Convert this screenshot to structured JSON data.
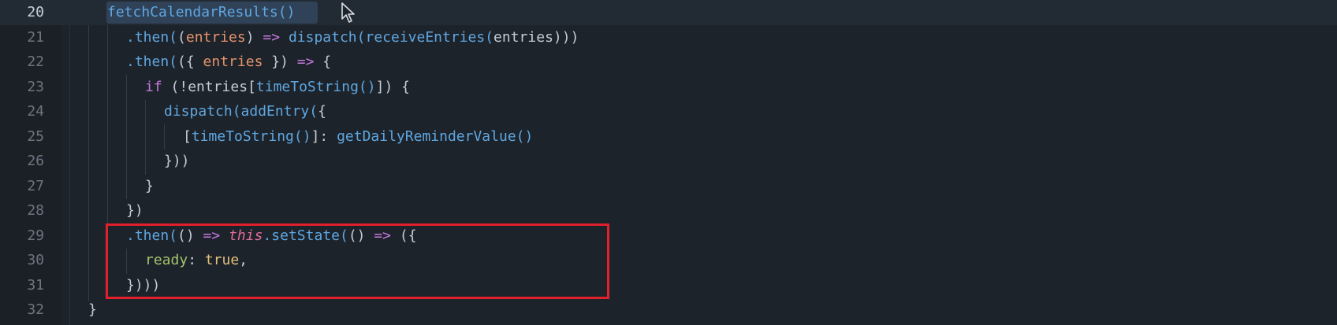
{
  "editor": {
    "accent_highlight_color": "#e0202b",
    "lines": [
      {
        "number": "20",
        "text": "fetchCalendarResults()"
      },
      {
        "number": "21",
        "text": ".then((entries) => dispatch(receiveEntries(entries)))"
      },
      {
        "number": "22",
        "text": ".then(({ entries }) => {"
      },
      {
        "number": "23",
        "text": "if (!entries[timeToString()]) {"
      },
      {
        "number": "24",
        "text": "dispatch(addEntry({"
      },
      {
        "number": "25",
        "text": "[timeToString()]: getDailyReminderValue()"
      },
      {
        "number": "26",
        "text": "}))"
      },
      {
        "number": "27",
        "text": "}"
      },
      {
        "number": "28",
        "text": "})"
      },
      {
        "number": "29",
        "text": ".then(() => this.setState(() => ({"
      },
      {
        "number": "30",
        "text": "ready: true,"
      },
      {
        "number": "31",
        "text": "})))"
      },
      {
        "number": "32",
        "text": "}"
      }
    ],
    "tokens": {
      "l20": [
        "fetchCalendarResults()"
      ],
      "l21": [
        ".then(",
        "(",
        "entries",
        ")",
        " => ",
        "dispatch(",
        "receiveEntries(",
        "entries)))"
      ],
      "l22": [
        ".then(",
        "({ ",
        "entries",
        " })",
        " => ",
        "{"
      ],
      "l23": [
        "if ",
        "(!entries[",
        "timeToString()",
        "]) {"
      ],
      "l24": [
        "dispatch(",
        "addEntry(",
        "{"
      ],
      "l25": [
        "[",
        "timeToString()",
        "]: ",
        "getDailyReminderValue()"
      ],
      "l26": [
        "}))"
      ],
      "l27": [
        "}"
      ],
      "l28": [
        "})"
      ],
      "l29": [
        ".then(",
        "()",
        " => ",
        "this",
        ".setState(",
        "()",
        " => ",
        "({"
      ],
      "l30": [
        "ready",
        ": ",
        "true",
        ","
      ],
      "l31": [
        "})))"
      ],
      "l32": [
        "}"
      ]
    }
  },
  "cursor_icon": "mouse-pointer-icon"
}
